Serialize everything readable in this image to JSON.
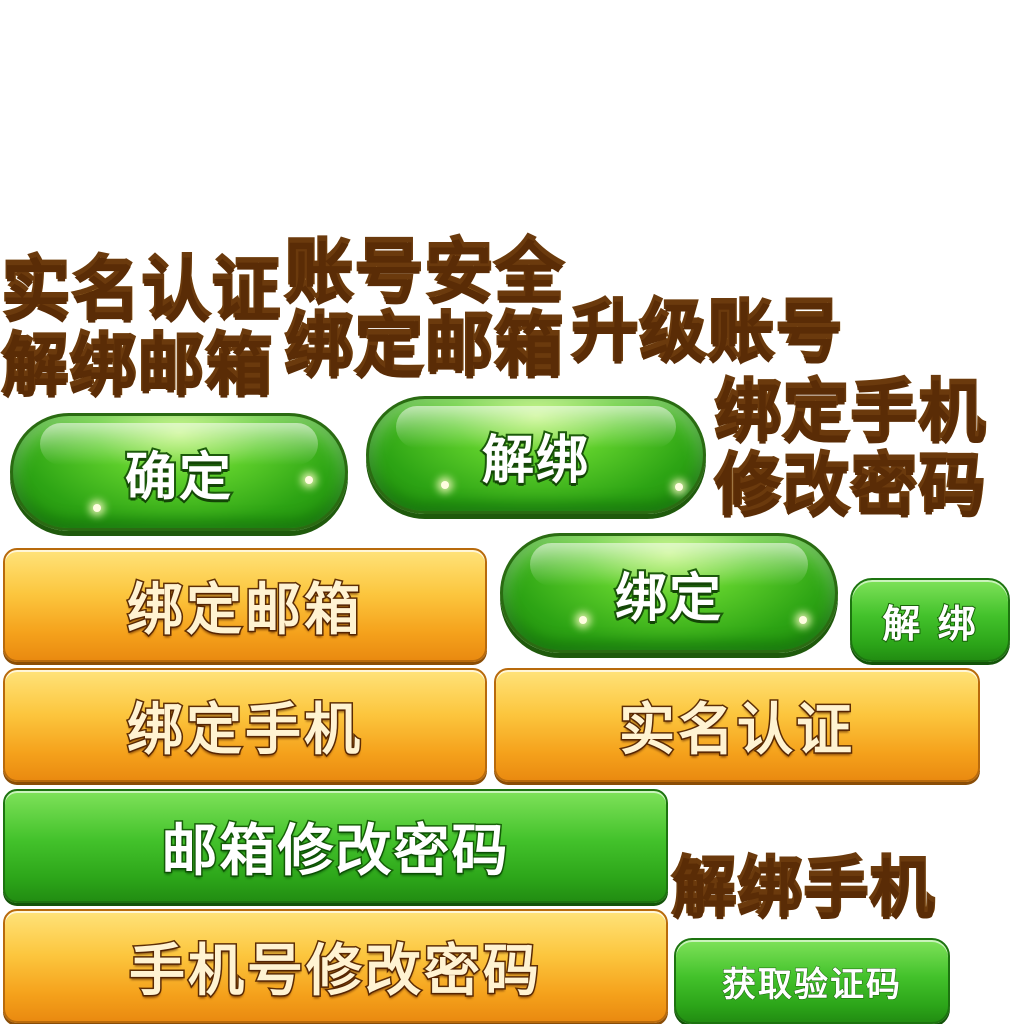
{
  "titles": {
    "real_name": "实名认证",
    "account_security": "账号安全",
    "unbind_email": "解绑邮箱",
    "bind_email": "绑定邮箱",
    "upgrade_account": "升级账号",
    "bind_phone": "绑定手机",
    "change_password": "修改密码",
    "unbind_phone": "解绑手机"
  },
  "buttons": {
    "confirm": "确定",
    "unbind_large": "解绑",
    "bind_large": "绑定",
    "unbind_small": "解 绑",
    "bind_email": "绑定邮箱",
    "bind_phone": "绑定手机",
    "real_name": "实名认证",
    "email_change_password": "邮箱修改密码",
    "phone_change_password": "手机号修改密码",
    "get_code": "获取验证码"
  },
  "colors": {
    "gold_text": "#ffd76a",
    "green_button": "#2da414",
    "orange_button": "#f5a21c",
    "text_outline": "#6b3a0d"
  }
}
